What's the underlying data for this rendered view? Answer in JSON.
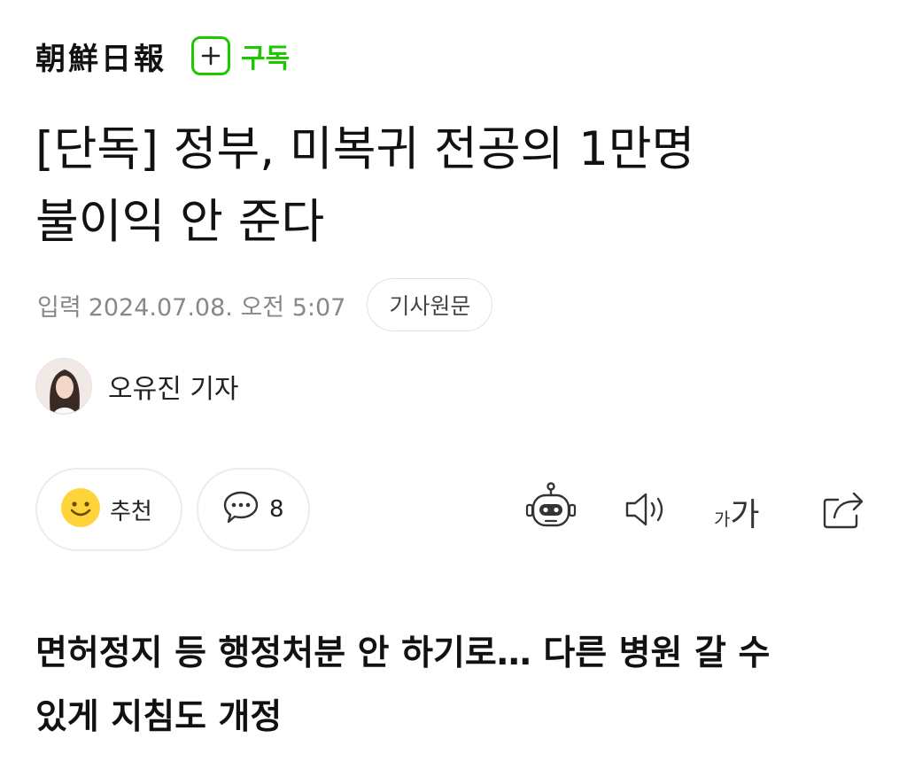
{
  "header": {
    "press_name": "朝鮮日報",
    "subscribe_label": "구독"
  },
  "article": {
    "title_line1": "[단독] 정부, 미복귀 전공의 1만명",
    "title_line2": "불이익 안 준다",
    "date_label": "입력",
    "date_value": "2024.07.08. 오전 5:07",
    "original_link": "기사원문",
    "reporter": "오유진 기자",
    "subtitle_line1": "면허정지 등 행정처분 안 하기로… 다른 병원 갈 수",
    "subtitle_line2": "있게 지침도 개정"
  },
  "actions": {
    "recommend_label": "추천",
    "comment_count": "8",
    "font_size_small": "가",
    "font_size_large": "가"
  },
  "colors": {
    "accent_green": "#1ec800",
    "reaction_yellow": "#ffd43b",
    "text_main": "#111111",
    "text_meta": "#888888",
    "border": "#ececec"
  },
  "icons": [
    "plus-icon",
    "smiley-icon",
    "speech-bubble-icon",
    "robot-summary-icon",
    "speaker-icon",
    "font-size-icon",
    "share-icon"
  ]
}
